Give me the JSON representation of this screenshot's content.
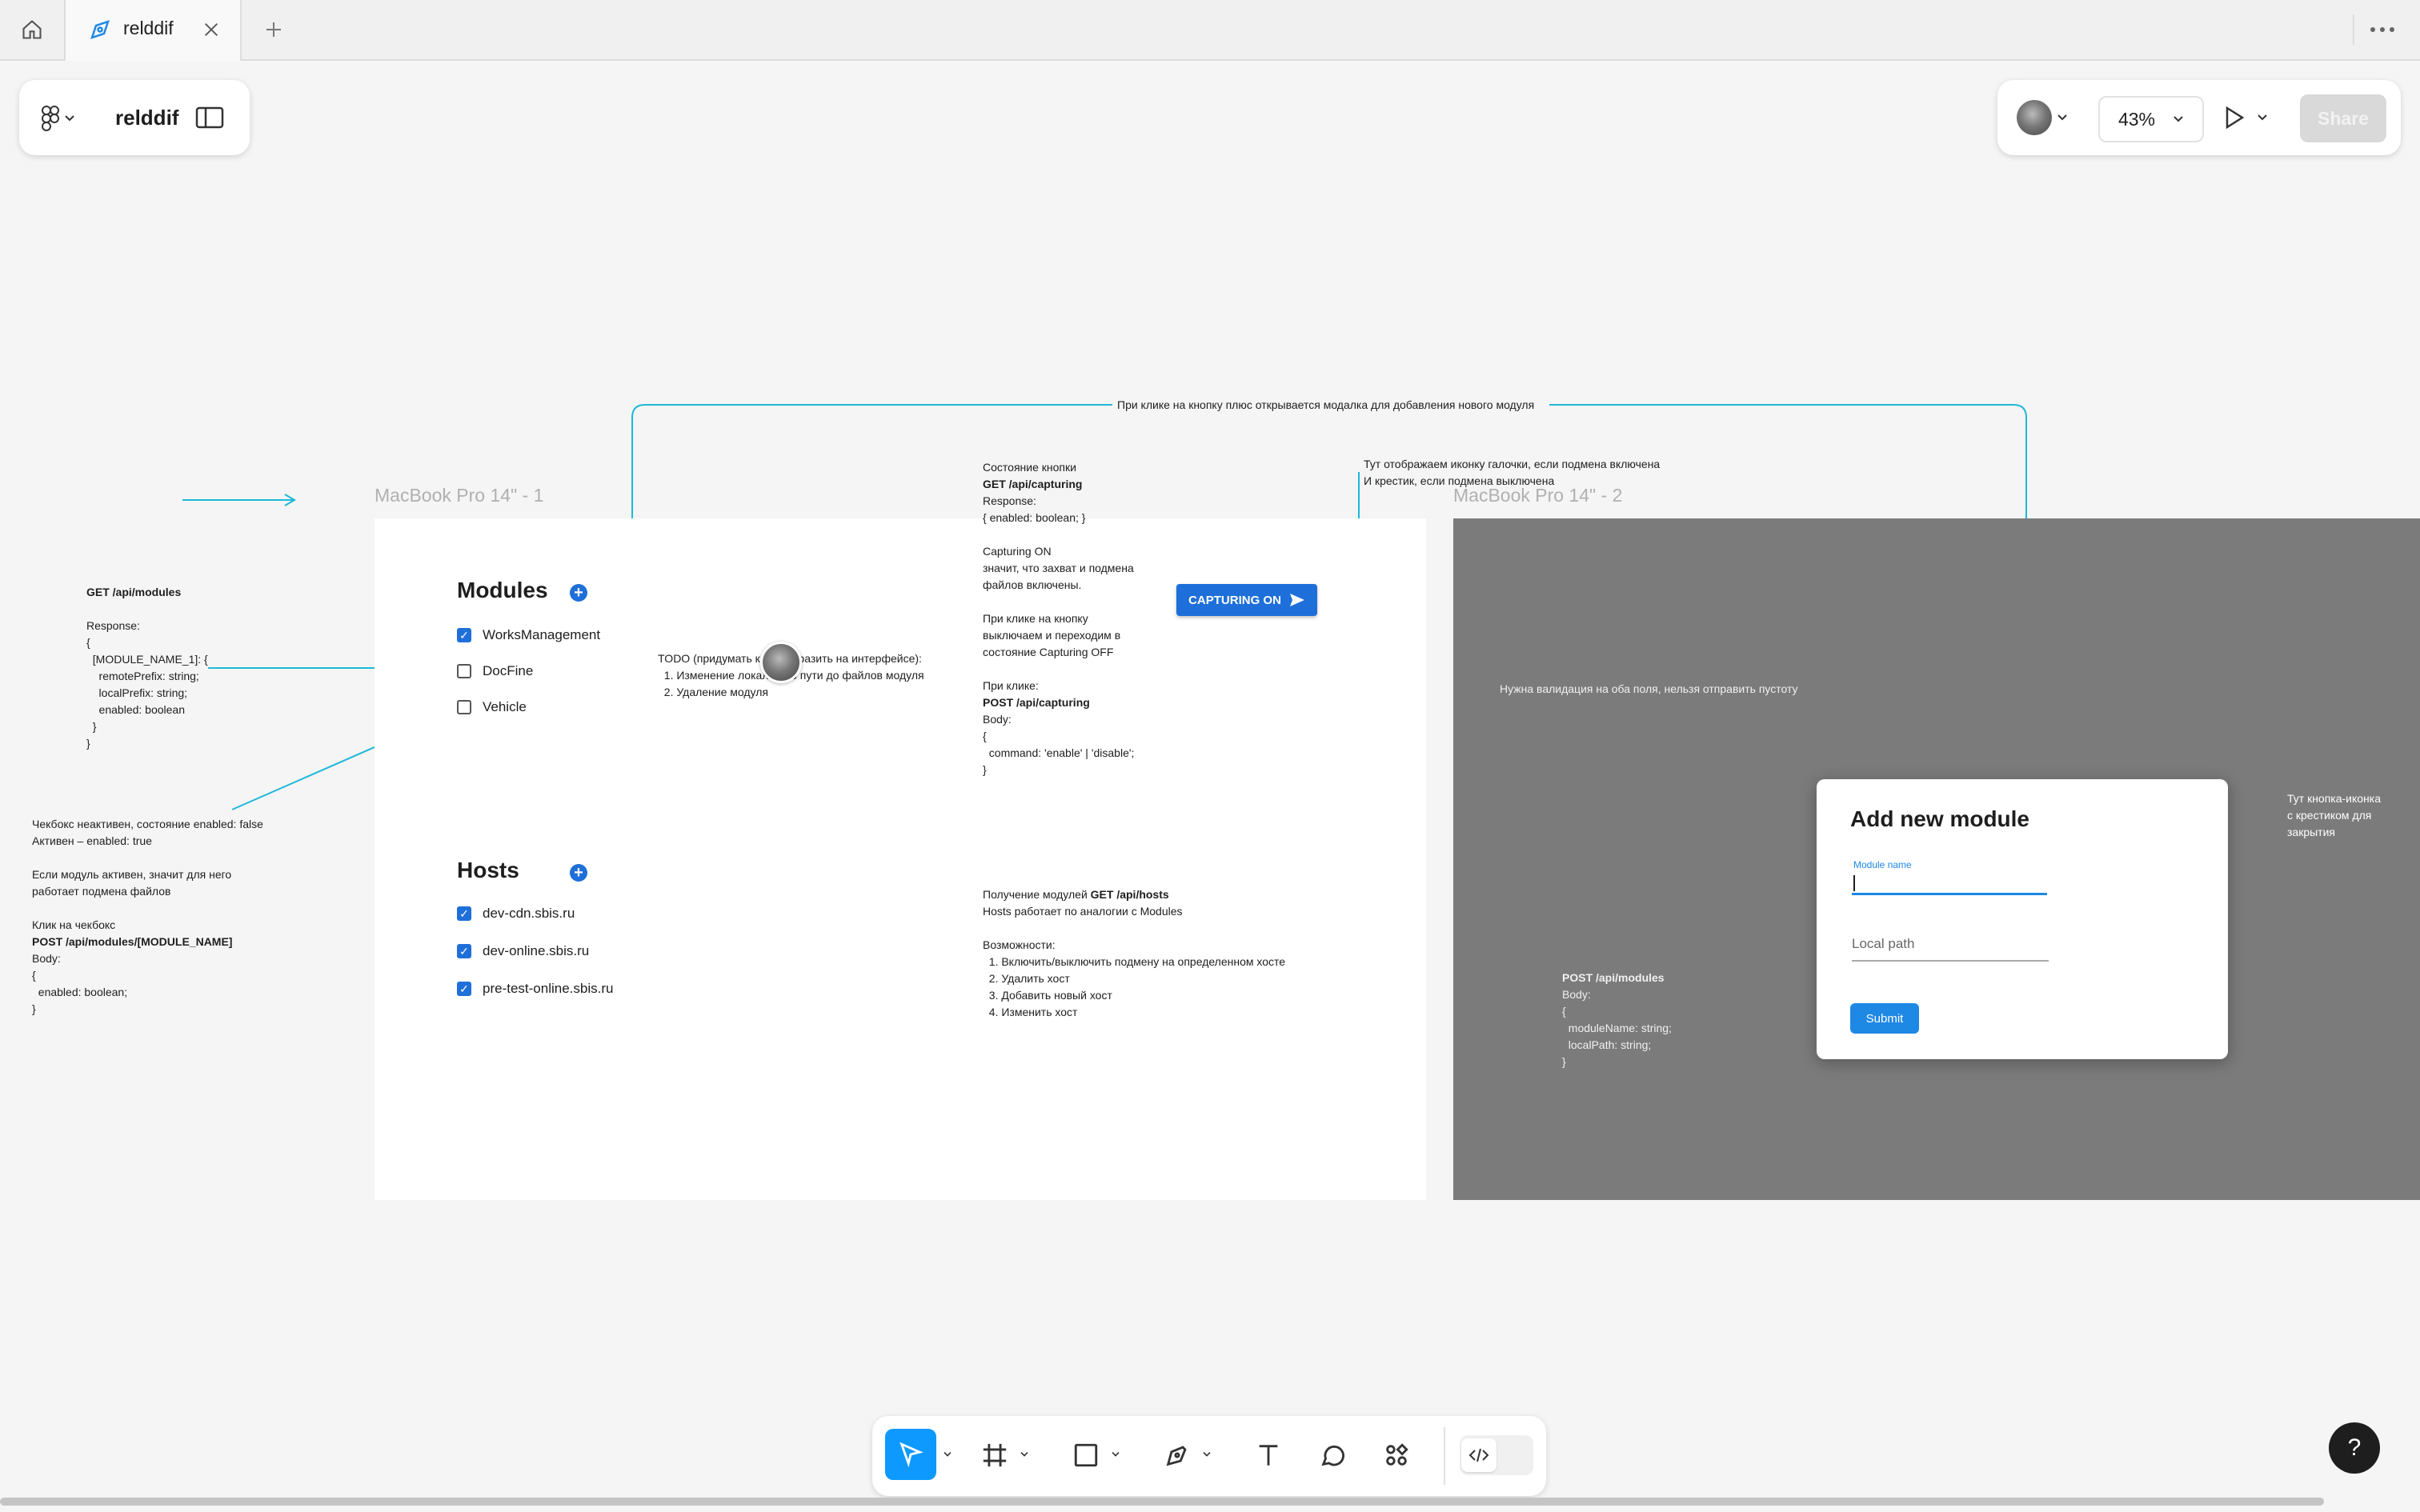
{
  "tabs": {
    "home_icon": "home-icon",
    "active_tab_label": "relddif",
    "add_icon": "plus-icon",
    "more_icon": "more-horizontal-icon"
  },
  "file_panel": {
    "file_name": "relddif"
  },
  "right_panel": {
    "zoom": "43%",
    "share_label": "Share"
  },
  "canvas": {
    "frame1_label": "MacBook Pro 14\" - 1",
    "frame2_label": "MacBook Pro 14\" - 2",
    "top_note": "При клике на кнопку плюс открывается модалка для добавления нового модуля",
    "modules": {
      "title": "Modules",
      "items": [
        {
          "label": "WorksManagement",
          "checked": true
        },
        {
          "label": "DocFine",
          "checked": false
        },
        {
          "label": "Vehicle",
          "checked": false
        }
      ]
    },
    "hosts": {
      "title": "Hosts",
      "items": [
        {
          "label": "dev-cdn.sbis.ru",
          "checked": true
        },
        {
          "label": "dev-online.sbis.ru",
          "checked": true
        },
        {
          "label": "pre-test-online.sbis.ru",
          "checked": true
        }
      ]
    },
    "capturing_button": "CAPTURING ON",
    "modal": {
      "title": "Add new module",
      "module_name_label": "Module name",
      "local_path_placeholder": "Local path",
      "submit_label": "Submit"
    },
    "notes": {
      "get_modules_title": "GET /api/modules",
      "get_modules_body": "Response:\n{\n  [MODULE_NAME_1]: {\n    remotePrefix: string;\n    localPrefix: string;\n    enabled: boolean\n  }\n}",
      "checkbox_note_1": "Чекбокс неактивен, состояние enabled: false\nАктивен – enabled: true\n\nЕсли модуль активен, значит для него\nработает подмена файлов\n\nКлик на чекбокс",
      "checkbox_note_post": "POST /api/modules/[MODULE_NAME]",
      "checkbox_note_2": "Body:\n{\n  enabled: boolean;\n}",
      "todo_note": "TODO (придумать как отобразить на интерфейсе):\n  1. Изменение локального пути до файлов модуля\n  2. Удаление модуля",
      "capturing_state_title": "Состояние кнопки",
      "capturing_get": "GET /api/capturing",
      "capturing_resp": "Response:\n{ enabled: boolean; }\n\nCapturing ON\nзначит, что захват и подмена\nфайлов включены.\n\nПри клике на кнопку\nвыключаем и переходим в\nсостояние Capturing OFF\n\nПри клике:",
      "capturing_post": "POST /api/capturing",
      "capturing_body": "Body:\n{\n  command: 'enable' | 'disable';\n}",
      "icon_note": "Тут отображаем иконку галочки, если подмена включена\nИ крестик, если подмена выключена",
      "hosts_note_prefix": "Получение модулей ",
      "hosts_note_get": "GET /api/hosts",
      "hosts_note_body": "Hosts работает по аналогии с Modules\n\nВозможности:\n  1. Включить/выключить подмену на определенном хосте\n  2. Удалить хост\n  3. Добавить новый хост\n  4. Изменить хост",
      "validation_note": "Нужна валидация на оба поля, нельзя отправить пустоту",
      "post_modules_title": "POST /api/modules",
      "post_modules_body": "Body:\n{\n  moduleName: string;\n  localPath: string;\n}",
      "close_icon_note": "Тут кнопка-иконка\nс крестиком для\nзакрытия"
    }
  },
  "toolbar": {
    "tools": [
      "move-tool",
      "frame-tool",
      "shape-tool",
      "pen-tool",
      "text-tool",
      "comment-tool",
      "actions-tool",
      "dev-mode-toggle"
    ]
  },
  "help_label": "?",
  "colors": {
    "accent": "#0d99ff",
    "ui_blue": "#1e6fd9",
    "connector": "#1fb8d8"
  }
}
